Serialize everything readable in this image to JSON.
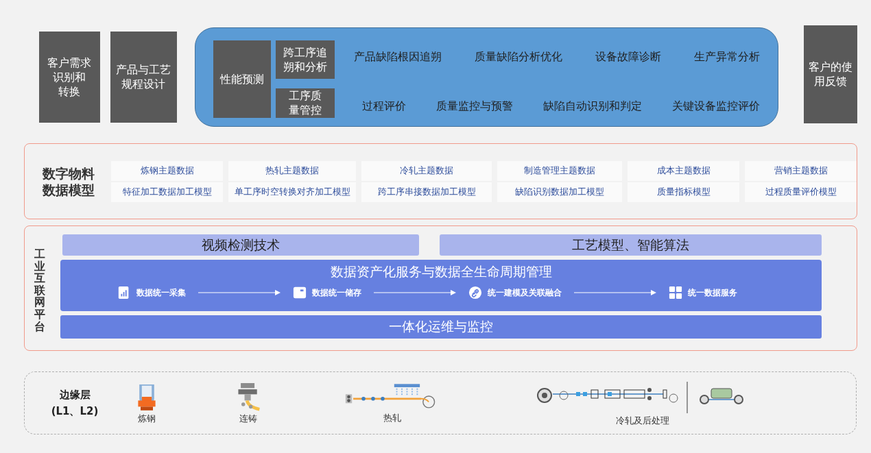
{
  "top_row": {
    "left_boxes": [
      {
        "lines": [
          "客户需求",
          "识别和",
          "转换"
        ]
      },
      {
        "lines": [
          "产品与工艺",
          "规程设计"
        ]
      }
    ],
    "analysis_panel": {
      "main_box": "性能预测",
      "side_boxes": [
        {
          "lines": [
            "跨工序追",
            "朔和分析"
          ]
        },
        {
          "lines": [
            "工序质",
            "量管控"
          ]
        }
      ],
      "rows": [
        [
          "产品缺陷根因追朔",
          "质量缺陷分析优化",
          "设备故障诊断",
          "生产异常分析"
        ],
        [
          "过程评价",
          "质量监控与预警",
          "缺陷自动识别和判定",
          "关键设备监控评价"
        ]
      ]
    },
    "right_box": {
      "lines": [
        "客户的使",
        "用反馈"
      ]
    }
  },
  "data_model": {
    "title_lines": [
      "数字物料",
      "数据模型"
    ],
    "columns": [
      {
        "theme": "炼钢主题数据",
        "model": "特征加工数据加工模型"
      },
      {
        "theme": "热轧主题数据",
        "model": "单工序时空转换对齐加工模型"
      },
      {
        "theme": "冷轧主题数据",
        "model": "跨工序串接数据加工模型"
      },
      {
        "theme": "制造管理主题数据",
        "model": "缺陷识别数据加工模型"
      },
      {
        "theme": "成本主题数据",
        "model": "质量指标模型"
      },
      {
        "theme": "营销主题数据",
        "model": "过程质量评价模型"
      }
    ]
  },
  "platform": {
    "title": "工业互联网平台",
    "top_bars": [
      "视频检测技术",
      "工艺模型、智能算法"
    ],
    "data_service": {
      "title": "数据资产化服务与数据全生命周期管理",
      "steps": [
        {
          "kind": "collect",
          "label": "数据统一采集"
        },
        {
          "kind": "store",
          "label": "数据统一储存"
        },
        {
          "kind": "link",
          "label": "统一建模及关联融合"
        },
        {
          "kind": "serve",
          "label": "统一数据服务"
        }
      ]
    },
    "bottom_bar": "一体化运维与监控"
  },
  "edge_layer": {
    "title_lines": [
      "边缘层",
      "(L1、L2)"
    ],
    "stages": [
      {
        "kind": "steelmaking",
        "label": "炼钢"
      },
      {
        "kind": "casting",
        "label": "连铸"
      },
      {
        "kind": "hot_rolling",
        "label": "热轧"
      },
      {
        "kind": "cold_rolling",
        "label": "冷轧及后处理"
      }
    ]
  }
}
